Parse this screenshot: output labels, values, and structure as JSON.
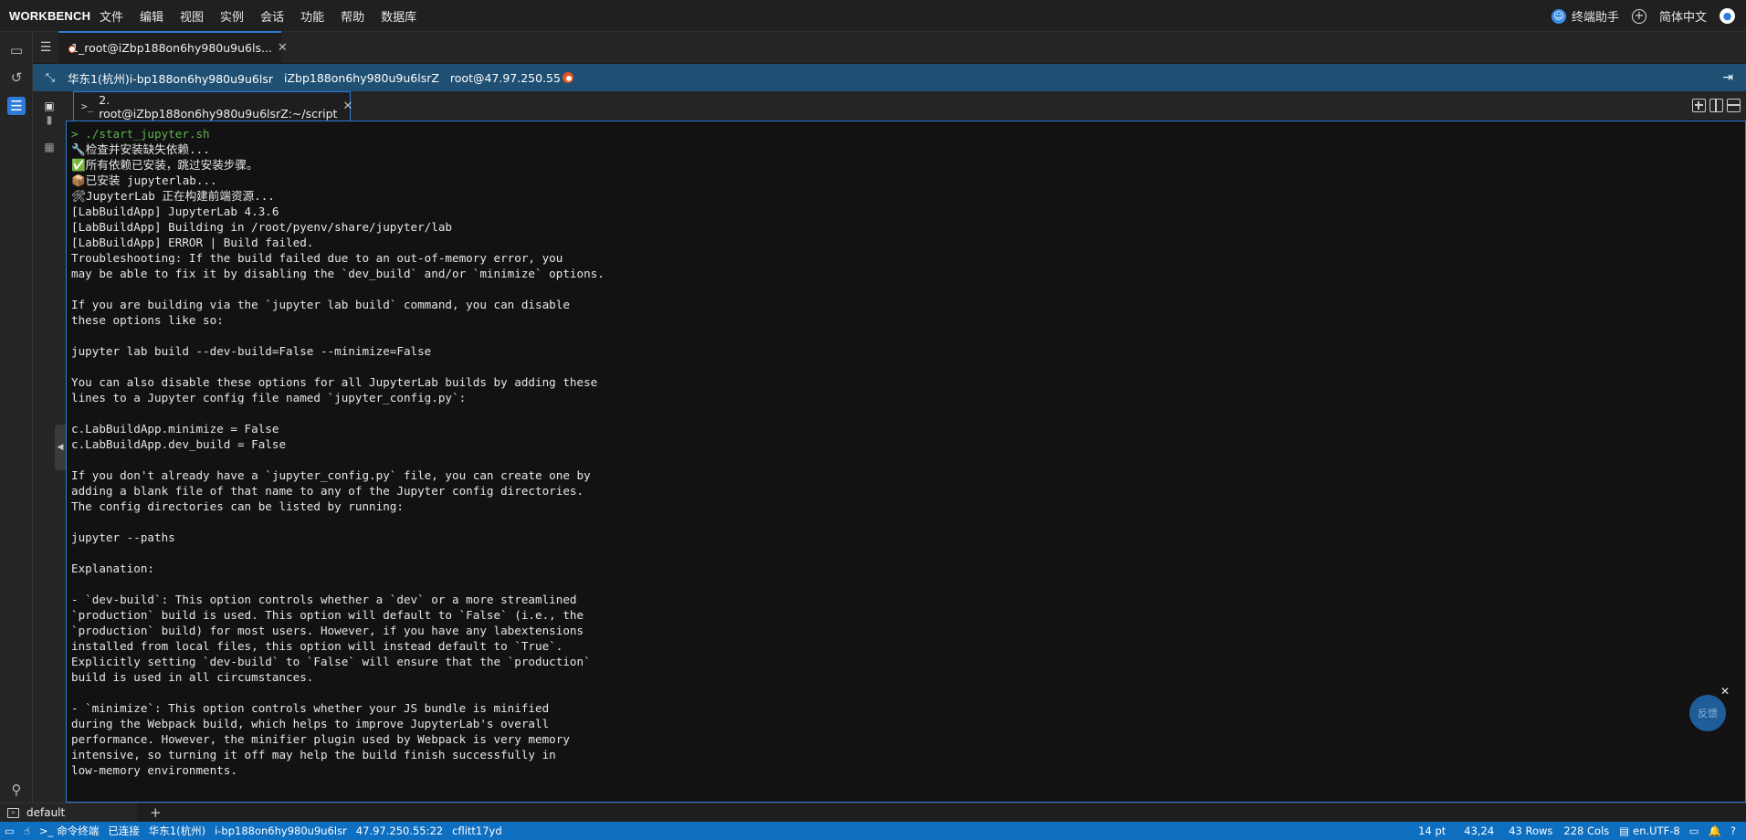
{
  "menubar": {
    "brand": "WORKBENCH",
    "items": [
      "文件",
      "编辑",
      "视图",
      "实例",
      "会话",
      "功能",
      "帮助",
      "数据库"
    ],
    "assistant_label": "终端助手",
    "language_label": "简体中文"
  },
  "session_tab": {
    "label": "1_root@iZbp188on6hy980u9u6ls..."
  },
  "infobar": {
    "region_instance": "华东1(杭州)i-bp188on6hy980u9u6lsr",
    "hostname": "iZbp188on6hy980u9u6lsrZ",
    "user_ip": "root@47.97.250.55"
  },
  "terminal_tab": {
    "label": "2. root@iZbp188on6hy980u9u6lsrZ:~/script"
  },
  "terminal": {
    "command": "> ./start_jupyter.sh",
    "lines": [
      "🔧检查并安装缺失依赖...",
      "✅所有依赖已安装，跳过安装步骤。",
      "📦已安装 jupyterlab...",
      "🛠JupyterLab 正在构建前端资源...",
      "[LabBuildApp] JupyterLab 4.3.6",
      "[LabBuildApp] Building in /root/pyenv/share/jupyter/lab",
      "[LabBuildApp] ERROR | Build failed.",
      "Troubleshooting: If the build failed due to an out-of-memory error, you",
      "may be able to fix it by disabling the `dev_build` and/or `minimize` options.",
      "",
      "If you are building via the `jupyter lab build` command, you can disable",
      "these options like so:",
      "",
      "jupyter lab build --dev-build=False --minimize=False",
      "",
      "You can also disable these options for all JupyterLab builds by adding these",
      "lines to a Jupyter config file named `jupyter_config.py`:",
      "",
      "c.LabBuildApp.minimize = False",
      "c.LabBuildApp.dev_build = False",
      "",
      "If you don't already have a `jupyter_config.py` file, you can create one by",
      "adding a blank file of that name to any of the Jupyter config directories.",
      "The config directories can be listed by running:",
      "",
      "jupyter --paths",
      "",
      "Explanation:",
      "",
      "- `dev-build`: This option controls whether a `dev` or a more streamlined",
      "`production` build is used. This option will default to `False` (i.e., the",
      "`production` build) for most users. However, if you have any labextensions",
      "installed from local files, this option will instead default to `True`.",
      "Explicitly setting `dev-build` to `False` will ensure that the `production`",
      "build is used in all circumstances.",
      "",
      "- `minimize`: This option controls whether your JS bundle is minified",
      "during the Webpack build, which helps to improve JupyterLab's overall",
      "performance. However, the minifier plugin used by Webpack is very memory",
      "intensive, so turning it off may help the build finish successfully in",
      "low-memory environments."
    ]
  },
  "float_button": {
    "label": "反馈"
  },
  "bottom": {
    "session_name": "default"
  },
  "statusbar": {
    "command_terminal": "命令终端",
    "connected": "已连接",
    "region": "华东1(杭州)",
    "instance": "i-bp188on6hy980u9u6lsr",
    "ip_port": "47.97.250.55:22",
    "session_id": "cflitt17yd",
    "font_size": "14 pt",
    "cursor": "43,24",
    "rows": "43 Rows",
    "cols": "228 Cols",
    "encoding": "en.UTF-8"
  },
  "colors": {
    "accent": "#2d7bd8",
    "infobar": "#1f4f72",
    "statusbar": "#0e6ebf",
    "terminal_bg": "#121212",
    "command_green": "#5fb34d"
  }
}
